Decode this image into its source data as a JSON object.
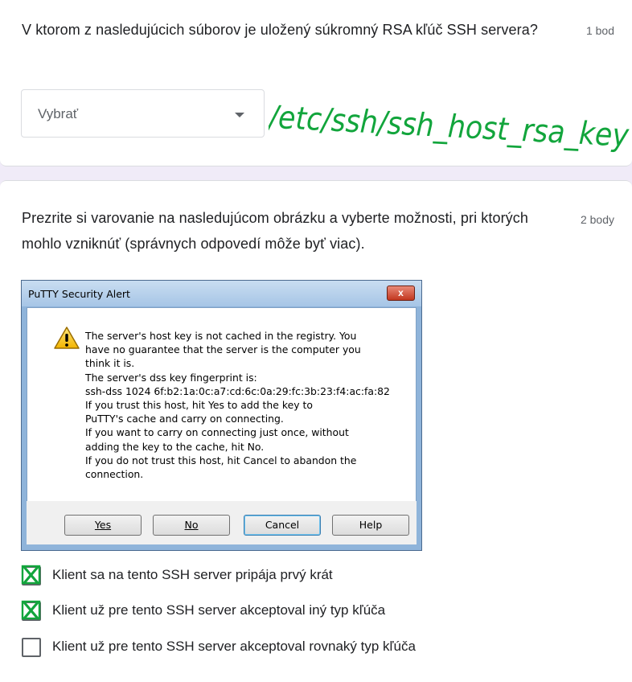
{
  "question1": {
    "text": "V ktorom z nasledujúcich súborov je uložený súkromný RSA kľúč SSH servera?",
    "points": "1 bod",
    "dropdown_placeholder": "Vybrať",
    "handwritten_answer": "/etc/ssh/ssh_host_rsa_key"
  },
  "question2": {
    "text": "Prezrite si varovanie na nasledujúcom obrázku a vyberte možnosti, pri ktorých mohlo vzniknúť (správnych odpovedí môže byť viac).",
    "points": "2 body",
    "dialog": {
      "title": "PuTTY Security Alert",
      "close_label": "x",
      "message_lines": [
        "The server's host key is not cached in the registry. You",
        "have no guarantee that the server is the computer you",
        "think it is.",
        "The server's dss key fingerprint is:",
        "ssh-dss 1024 6f:b2:1a:0c:a7:cd:6c:0a:29:fc:3b:23:f4:ac:fa:82",
        "If you trust this host, hit Yes to add the key to",
        "PuTTY's cache and carry on connecting.",
        "If you want to carry on connecting just once, without",
        "adding the key to the cache, hit No.",
        "If you do not trust this host, hit Cancel to abandon the",
        "connection."
      ],
      "buttons": {
        "yes": "Yes",
        "no": "No",
        "cancel": "Cancel",
        "help": "Help"
      }
    },
    "options": [
      {
        "label": "Klient sa na tento SSH server pripája prvý krát",
        "marked": true
      },
      {
        "label": "Klient už pre tento SSH server akceptoval iný typ kľúča",
        "marked": true
      },
      {
        "label": "Klient už pre tento SSH server akceptoval rovnaký typ kľúča",
        "marked": false
      }
    ]
  },
  "colors": {
    "background": "#f0ebf8",
    "hand_marks": "#12a53c",
    "text": "#202124",
    "secondary_text": "#5f6368"
  }
}
